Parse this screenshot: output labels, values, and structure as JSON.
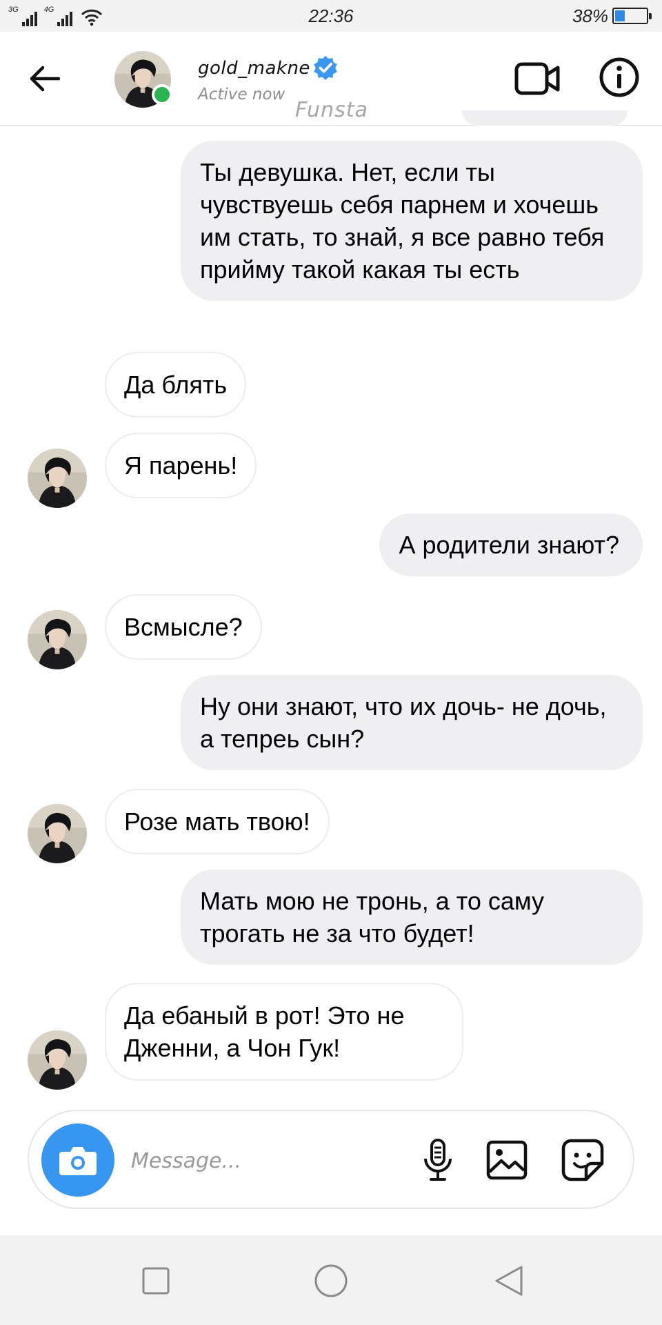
{
  "status_bar": {
    "signal_1": "3G",
    "signal_2": "4G",
    "time": "22:36",
    "battery_percent": "38%",
    "battery_level": 0.38,
    "battery_color": "#2f8ae5"
  },
  "header": {
    "back_icon": "arrow-left-icon",
    "username": "gold_makne",
    "verified_icon": "verified-badge-icon",
    "status": "Active now",
    "online_color": "#2ab552",
    "video_icon": "video-camera-icon",
    "info_icon": "info-icon"
  },
  "watermark": "Funsta",
  "messages": [
    {
      "side": "out",
      "text": "Ты девушка. Нет, если ты чувствуешь себя парнем и хочешь им стать, то знай, я все равно тебя прийму такой какая ты есть"
    },
    {
      "side": "in",
      "text": "Да блять"
    },
    {
      "side": "in",
      "text": "Я парень!"
    },
    {
      "side": "out",
      "text": "А родители знают?"
    },
    {
      "side": "in",
      "text": "Всмысле?"
    },
    {
      "side": "out",
      "text": "Ну они знают, что их дочь- не дочь, а тепреь сын?"
    },
    {
      "side": "in",
      "text": "Розе мать твою!"
    },
    {
      "side": "out",
      "text": "Мать мою не тронь, а то саму трогать не за что будет!"
    },
    {
      "side": "in",
      "text": "Да ебаный в рот! Это не Дженни, а Чон Гук!"
    }
  ],
  "composer": {
    "camera_icon": "camera-icon",
    "placeholder": "Message...",
    "mic_icon": "microphone-icon",
    "gallery_icon": "image-icon",
    "sticker_icon": "sticker-icon",
    "accent_color": "#3797f0"
  },
  "nav_bar": {
    "recents_icon": "square-icon",
    "home_icon": "circle-icon",
    "back_icon": "triangle-back-icon"
  }
}
